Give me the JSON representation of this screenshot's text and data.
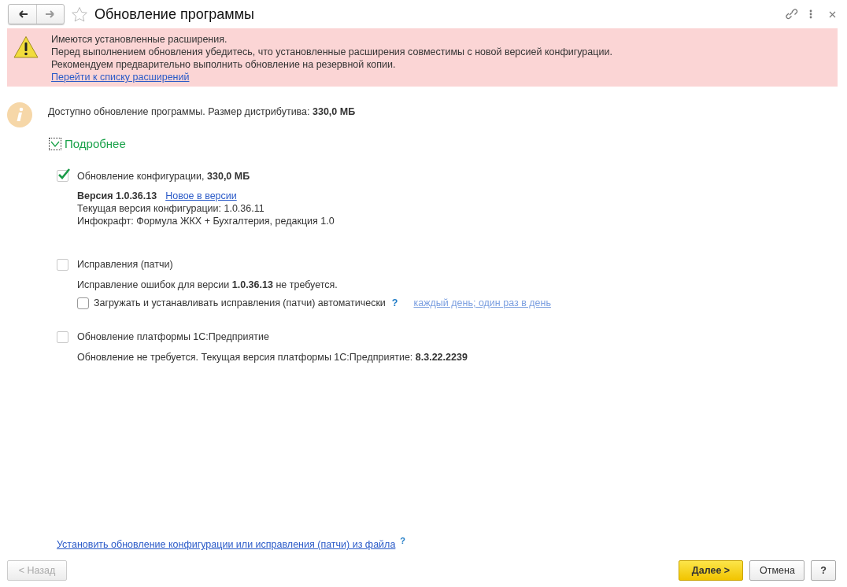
{
  "window": {
    "title": "Обновление программы",
    "favorite": false
  },
  "warning": {
    "lines": [
      "Имеются установленные расширения.",
      "Перед выполнением обновления убедитесь, что установленные расширения совместимы с новой версией конфигурации.",
      "Рекомендуем предварительно выполнить обновление на резервной копии."
    ],
    "link": "Перейти к списку расширений"
  },
  "info": "Доступно обновление программы. Размер дистрибутива: **330,0 МБ**",
  "details": {
    "label": "Подробнее",
    "expanded": true
  },
  "sections": [
    {
      "label": "Обновление конфигурации, **330,0 МБ**",
      "checked": true,
      "version": "Версия 1.0.36.13",
      "version_link": "Новое в версии",
      "lines": [
        "Текущая версия конфигурации: 1.0.36.11",
        "Инфокрафт: Формула ЖКХ + Бухгалтерия, редакция 1.0"
      ]
    },
    {
      "label": "Исправления (патчи)",
      "checked": false,
      "description": "Исправление ошибок для версии **1.0.36.13** не требуется.",
      "auto": {
        "label": "Загружать и устанавливать исправления (патчи) автоматически",
        "checked": false,
        "help": "?",
        "schedule": "каждый день; один раз в день"
      }
    },
    {
      "label": "Обновление платформы 1С:Предприятие",
      "checked": false,
      "description": "Обновление не требуется. Текущая версия платформы 1С:Предприятие: **8.3.22.2239**"
    }
  ],
  "file_link": {
    "label": "Установить обновление конфигурации или исправления (патчи) из файла",
    "help": "?"
  },
  "buttons": [
    {
      "label": "< Назад",
      "kind": "default",
      "disabled": true
    },
    {
      "label": "Далее >",
      "kind": "primary",
      "disabled": false
    },
    {
      "label": "Отмена",
      "kind": "default",
      "disabled": false
    },
    {
      "label": "?",
      "kind": "default",
      "disabled": false
    }
  ]
}
